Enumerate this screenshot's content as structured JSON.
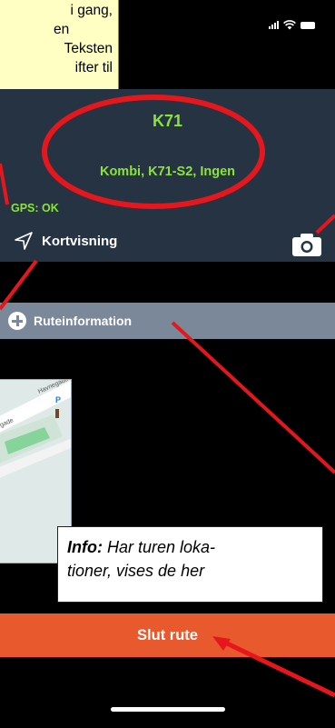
{
  "note": {
    "lines": [
      "i gang,",
      "en",
      "Teksten",
      "ifter til"
    ]
  },
  "header": {
    "title": "K71",
    "subtitle": "Kombi, K71-S2, Ingen",
    "gps": "GPS: OK",
    "map_view_label": "Kortvisning"
  },
  "route_info": {
    "label": "Ruteinformation"
  },
  "map_thumb": {
    "street_label": "Havnegade",
    "street_label_2": "gade"
  },
  "info_box": {
    "bold": "Info:",
    "text_1": "Har turen loka-",
    "text_2": "tioner, vises de her"
  },
  "footer": {
    "end_button": "Slut rute"
  },
  "colors": {
    "card_bg": "#253342",
    "accent_green": "#8be33a",
    "route_bar": "#7a8899",
    "end_button": "#e8592d",
    "annotation_red": "#e5171c"
  }
}
